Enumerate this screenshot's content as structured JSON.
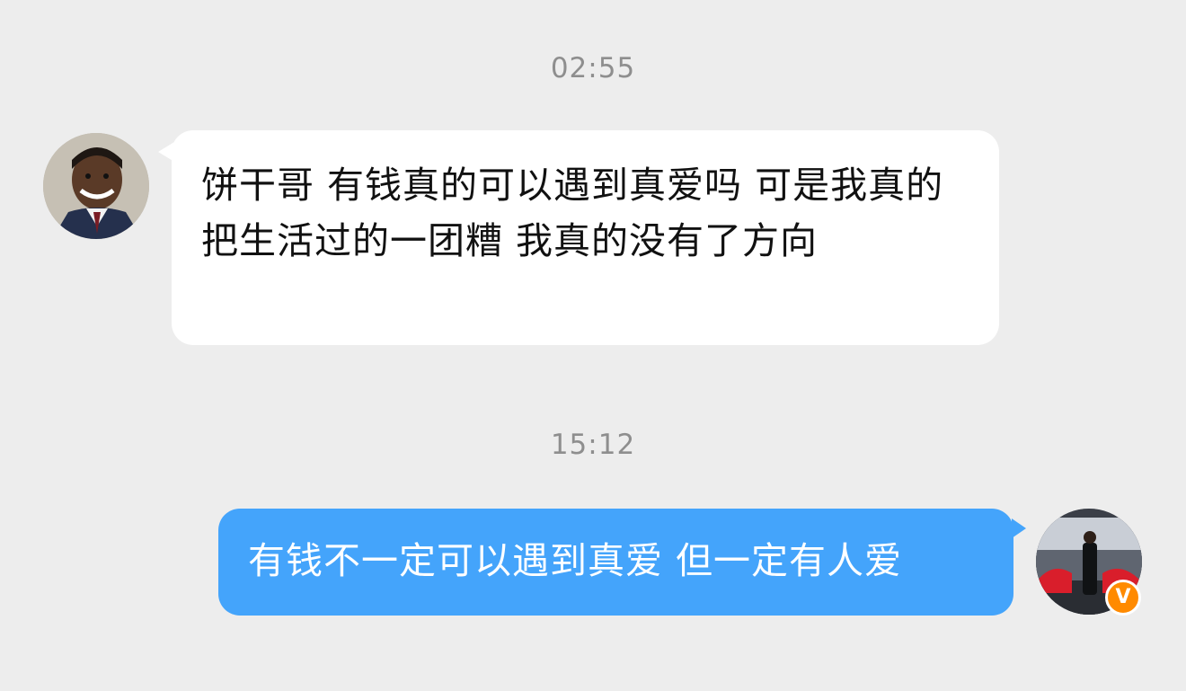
{
  "messages": [
    {
      "time": "02:55",
      "sender": "contact",
      "avatar_icon": "child-portrait-avatar",
      "text": "饼干哥  有钱真的可以遇到真爱吗 可是我真的把生活过的一团糟 我真的没有了方向"
    },
    {
      "time": "15:12",
      "sender": "self",
      "avatar_icon": "car-garage-portrait-avatar",
      "verified_badge": "V",
      "text": "有钱不一定可以遇到真爱 但一定有人爱"
    }
  ],
  "colors": {
    "background": "#ededed",
    "incoming_bubble": "#ffffff",
    "outgoing_bubble": "#44a4fb",
    "timestamp": "#8e8e8e",
    "badge": "#ff8a00"
  }
}
